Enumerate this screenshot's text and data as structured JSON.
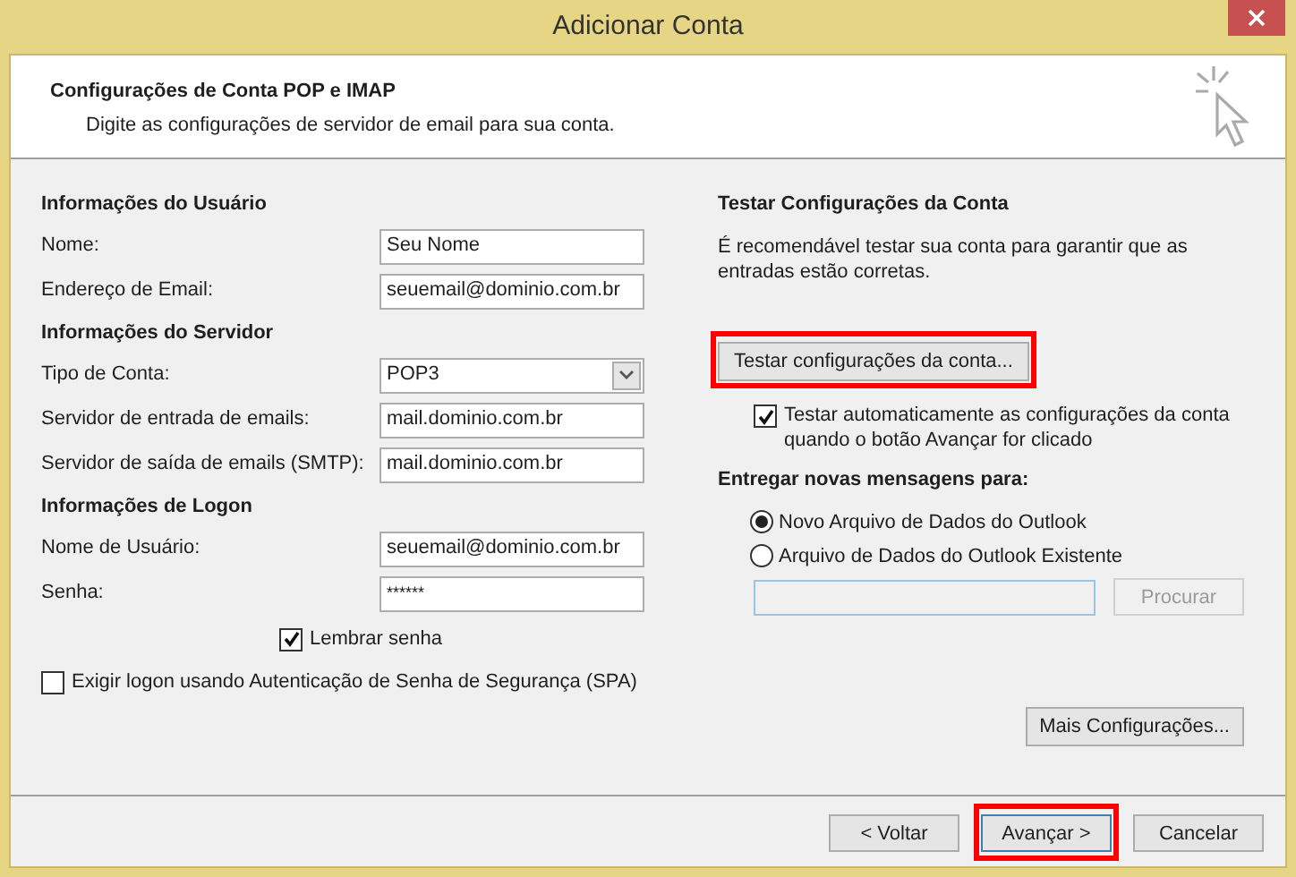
{
  "window": {
    "title": "Adicionar Conta"
  },
  "header": {
    "title": "Configurações de Conta POP e IMAP",
    "subtitle": "Digite as configurações de servidor de email para sua conta."
  },
  "sections": [
    {
      "heading": "Informações do Usuário",
      "fields": [
        {
          "label": "Nome:",
          "value": "Seu Nome",
          "kind": "text"
        },
        {
          "label": "Endereço de Email:",
          "value": "seuemail@dominio.com.br",
          "kind": "text"
        }
      ]
    },
    {
      "heading": "Informações do Servidor",
      "fields": [
        {
          "label": "Tipo de Conta:",
          "value": "POP3",
          "kind": "select"
        },
        {
          "label": "Servidor de entrada de emails:",
          "value": "mail.dominio.com.br",
          "kind": "text"
        },
        {
          "label": "Servidor de saída de emails (SMTP):",
          "value": "mail.dominio.com.br",
          "kind": "text"
        }
      ]
    },
    {
      "heading": "Informações de Logon",
      "fields": [
        {
          "label": "Nome de Usuário:",
          "value": "seuemail@dominio.com.br",
          "kind": "text"
        },
        {
          "label": "Senha:",
          "value": "******",
          "kind": "password"
        }
      ]
    }
  ],
  "remember_password": {
    "label": "Lembrar senha",
    "checked": true
  },
  "spa": {
    "label": "Exigir logon usando Autenticação de Senha de Segurança (SPA)",
    "checked": false
  },
  "test": {
    "heading": "Testar Configurações da Conta",
    "description": "É recomendável testar sua conta para garantir que as entradas estão corretas.",
    "button": {
      "label": "Testar configurações da conta...",
      "highlighted": true
    },
    "auto": {
      "label": "Testar automaticamente as configurações da conta quando o botão Avançar for clicado",
      "checked": true
    }
  },
  "deliver": {
    "heading": "Entregar novas mensagens para:",
    "options": [
      {
        "label": "Novo Arquivo de Dados do Outlook",
        "selected": true
      },
      {
        "label": "Arquivo de Dados do Outlook Existente",
        "selected": false
      }
    ],
    "browse": {
      "label": "Procurar",
      "disabled": true
    }
  },
  "more_button": {
    "label": "Mais Configurações..."
  },
  "footer_buttons": [
    {
      "label": "< Voltar",
      "highlighted": false
    },
    {
      "label": "Avançar >",
      "highlighted": true
    },
    {
      "label": "Cancelar",
      "highlighted": false
    }
  ]
}
